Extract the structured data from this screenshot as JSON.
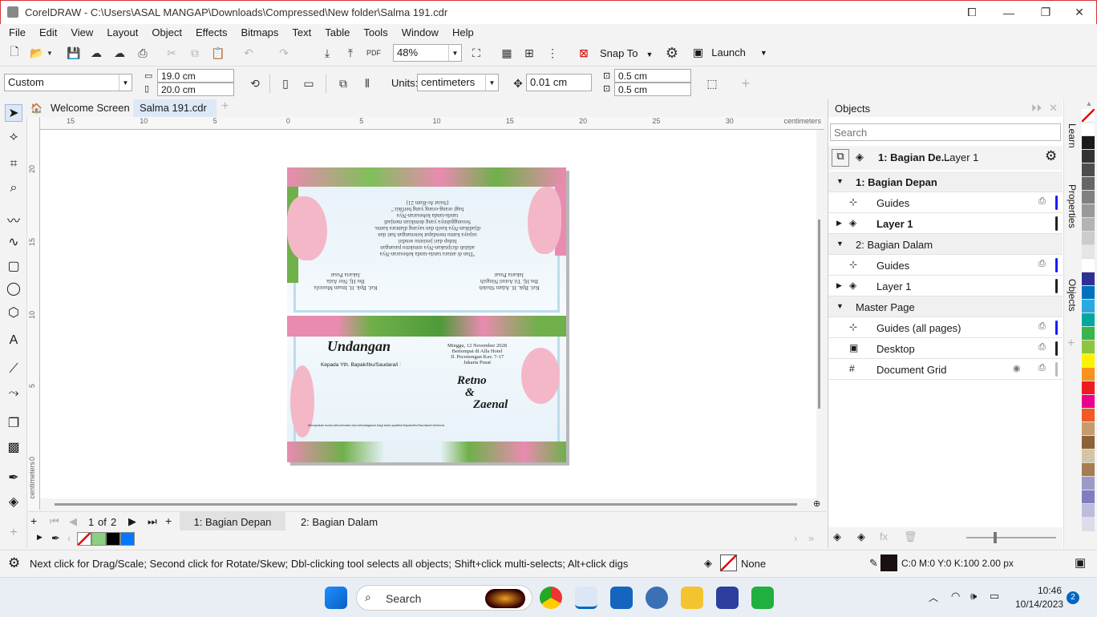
{
  "window": {
    "title": "CorelDRAW - C:\\Users\\ASAL MANGAP\\Downloads\\Compressed\\New folder\\Salma 191.cdr"
  },
  "menu": [
    "File",
    "Edit",
    "View",
    "Layout",
    "Object",
    "Effects",
    "Bitmaps",
    "Text",
    "Table",
    "Tools",
    "Window",
    "Help"
  ],
  "toolbar": {
    "zoom": "48%",
    "snap_to": "Snap To",
    "launch": "Launch",
    "pdf": "PDF"
  },
  "property_bar": {
    "page_preset": "Custom",
    "width": "19.0 cm",
    "height": "20.0 cm",
    "units_label": "Units:",
    "units": "centimeters",
    "nudge": "0.01 cm",
    "dup_x": "0.5 cm",
    "dup_y": "0.5 cm"
  },
  "doc_tabs": {
    "welcome": "Welcome Screen",
    "active": "Salma 191.cdr"
  },
  "ruler": {
    "unit": "centimeters",
    "h_ticks": [
      "15",
      "10",
      "5",
      "0",
      "5",
      "10",
      "15",
      "20",
      "25",
      "30"
    ],
    "v_ticks": [
      "20",
      "15",
      "10",
      "5",
      "0"
    ]
  },
  "invitation": {
    "front_title": "Undangan",
    "kepada": "Kepada Yth. Bapak/Ibu/Saudara/i :",
    "date_lines": [
      "Minggu, 12 November 2028",
      "Bertempat di Alfa Hotel",
      "Jl. Pecenongan Kav. 7-17",
      "Jakarta Pusat"
    ],
    "groom_bride": [
      "Retno",
      "&",
      "Zaenal"
    ],
    "footer": "Merupakan suatu kehormatan dan kebahagiaan bagi kami apabila Bapak/Ibu/Saudara/i berkenan hadir",
    "inner_quote": [
      "\"Dan di antara tanda-tanda kebesaran-Nya",
      "adalah diciptakan-Nya untukmu pasangan",
      "hidup dari jenismu sendiri",
      "supaya kamu mendapat ketenangan hati dan",
      "dijadikan-Nya kasih dan sayang diantara kamu.",
      "Sesungguhnya yang demikian menjadi",
      "tanda-tanda kebesaran-Nya",
      "bagi orang-orang yang berfikir.\"",
      "(Surat Ar-Rum 21)"
    ],
    "inner_left": [
      "Kel. Bpk. H. Imam Mustofa",
      "Ibu Hj. Nur Aida",
      "Jakarta Pusat"
    ],
    "inner_right": [
      "Kel. Bpk. H. Adam Sholeh",
      "Ibu Hj. Tri Astuti Ningsih",
      "Jakarta Pusat"
    ]
  },
  "page_nav": {
    "current": "1",
    "of": "of",
    "total": "2",
    "pages": [
      "1: Bagian Depan",
      "2: Bagian Dalam"
    ]
  },
  "docker": {
    "title": "Objects",
    "search_placeholder": "Search",
    "breadcrumb_page": "1: Bagian De...",
    "breadcrumb_layer": "Layer 1",
    "rows": [
      {
        "label": "1: Bagian Depan",
        "kind": "page",
        "bold": true
      },
      {
        "label": "Guides",
        "kind": "guides",
        "color": "#1a1aff"
      },
      {
        "label": "Layer 1",
        "kind": "layer",
        "bold": true,
        "color": "#222222"
      },
      {
        "label": "2: Bagian Dalam",
        "kind": "page"
      },
      {
        "label": "Guides",
        "kind": "guides",
        "color": "#1a1aff"
      },
      {
        "label": "Layer 1",
        "kind": "layer",
        "color": "#222222"
      },
      {
        "label": "Master Page",
        "kind": "page"
      },
      {
        "label": "Guides (all pages)",
        "kind": "guides",
        "color": "#1a1aff"
      },
      {
        "label": "Desktop",
        "kind": "desktop",
        "color": "#222222"
      },
      {
        "label": "Document Grid",
        "kind": "grid",
        "color": "#bbbbbb"
      }
    ]
  },
  "side_tabs": [
    "Learn",
    "Properties",
    "Objects"
  ],
  "palette_colors": [
    "#ffffff",
    "#1a1a1a",
    "#333333",
    "#4d4d4d",
    "#666666",
    "#808080",
    "#999999",
    "#b3b3b3",
    "#cccccc",
    "#e6e6e6",
    "#ffffff",
    "#2e3192",
    "#0071bc",
    "#29abe2",
    "#00a99d",
    "#39b54a",
    "#8cc63f",
    "#fff200",
    "#f7931e",
    "#ed1c24",
    "#ec008c",
    "#f15a24",
    "#c69c6d",
    "#8c6239",
    "#d3c5a5",
    "#a67c52",
    "#9e9ac8",
    "#7f7fbf",
    "#bcbcdc",
    "#dcdcec"
  ],
  "doc_palette": [
    "#8bd07e",
    "#000000",
    "#0078ff"
  ],
  "status": {
    "hint": "Next click for Drag/Scale; Second click for Rotate/Skew; Dbl-clicking tool selects all objects; Shift+click multi-selects; Alt+click digs",
    "fill": "None",
    "outline": "C:0 M:0 Y:0 K:100  2.00 px"
  },
  "taskbar": {
    "search": "Search",
    "time": "10:46",
    "date": "10/14/2023",
    "badge": "2"
  }
}
